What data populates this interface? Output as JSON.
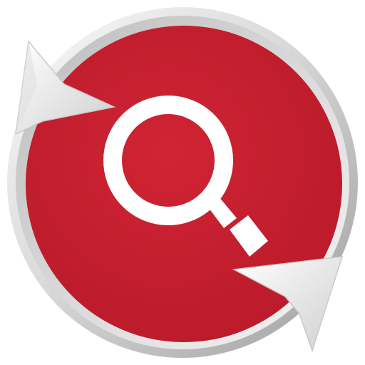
{
  "icon": {
    "name": "refresh-search-icon",
    "colors": {
      "background": "#ffffff",
      "disc": "#c81e2e",
      "disc_shadow": "#a51623",
      "ring_light": "#f4f4f4",
      "ring_mid": "#d9d9d9",
      "ring_dark": "#a9a9a9",
      "arrow": "#f2f2f2",
      "arrow_shade": "#bdbdbd",
      "magnifier": "#ffffff"
    },
    "glyphs": [
      "magnifier-icon",
      "refresh-arrow-icon"
    ]
  }
}
